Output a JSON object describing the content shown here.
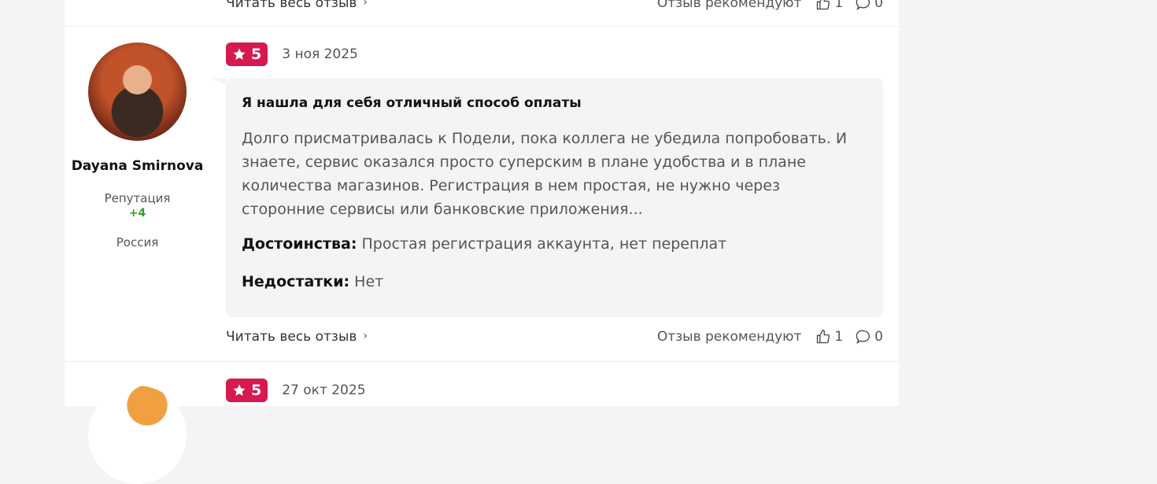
{
  "top_footer": {
    "read_more": "Читать весь отзыв",
    "recommend_label": "Отзыв рекомендуют",
    "likes": "1",
    "comments": "0"
  },
  "review": {
    "author": "Dayana Smirnova",
    "reputation_label": "Репутация",
    "reputation_value": "+4",
    "country": "Россия",
    "rating": "5",
    "date": "3 ноя 2025",
    "title": "Я нашла для себя отличный способ оплаты",
    "text": "Долго присматривалась к Подели, пока коллега не убедила попробовать. И знаете, сервис оказался просто суперским в плане удобства и в плане количества магазинов. Регистрация в нем простая, не нужно через сторонние сервисы или банковские приложения...",
    "pros_label": "Достоинства:",
    "pros": "Простая регистрация аккаунта, нет переплат",
    "cons_label": "Недостатки:",
    "cons": "Нет",
    "read_more": "Читать весь отзыв",
    "recommend_label": "Отзыв рекомендуют",
    "likes": "1",
    "comments": "0"
  },
  "next_review": {
    "rating": "5",
    "date": "27 окт 2025"
  },
  "colors": {
    "accent": "#d6194f",
    "reputation_positive": "#2f9e2f"
  }
}
